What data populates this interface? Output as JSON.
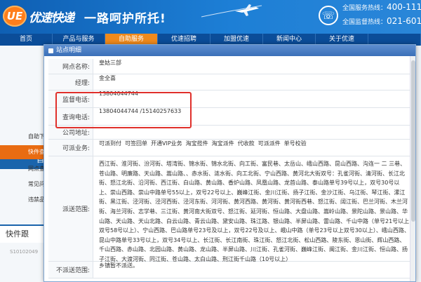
{
  "header": {
    "logo_mark": "UE",
    "logo_text": "优速快递",
    "slogan": "一路呵护所托!",
    "phone_icon": "phone-icon",
    "phone1_label": "全国服务热线：",
    "phone1": "400-111",
    "phone2_label": "全国监督热线：",
    "phone2": "021-601"
  },
  "nav": {
    "items": [
      {
        "label": "首页"
      },
      {
        "label": "产品与服务"
      },
      {
        "label": "自助服务"
      },
      {
        "label": "优速招聘"
      },
      {
        "label": "加盟优速"
      },
      {
        "label": "新闻中心"
      },
      {
        "label": "关于优速"
      },
      {
        "label": ""
      }
    ],
    "active_color": "#f08a1c"
  },
  "background_sidebar": {
    "items": [
      {
        "label": "自助下"
      },
      {
        "label": "快件查"
      },
      {
        "label": "网点查"
      },
      {
        "label": "常见问"
      },
      {
        "label": "违禁品"
      }
    ],
    "head": "自",
    "track_title": "快件跟",
    "track_number": "S10102049"
  },
  "dialog": {
    "title": "站点明细",
    "rows": {
      "name_label": "网点名称:",
      "name_value": "皇姑三部",
      "manager_label": "经理:",
      "manager_value": "金全喜",
      "supervise_label": "监督电话:",
      "supervise_value": "13804044744",
      "query_label": "查询电话:",
      "query_value": "13804044744 /15140257633",
      "address_label": "公司地址:",
      "address_value": "",
      "services_label": "可派业务:",
      "services": [
        "可派到付",
        "可签回单",
        "开通VIP业务",
        "淘宝揽件",
        "淘宝派件",
        "代收款",
        "可派派件",
        "单号校验"
      ],
      "area_label": "派送范围:",
      "area_value": "西江街、淮河街、汾河街、塔湾街、锦水街、锦水北街、向工街、富民巷、太岳山、峨山西路、昆山西路、沟连一 二 三巷、苍山路、明廉路、天山路、嵩山路、、赤水街、涟水街、向工北街、宁山西路、黄河北大街双号：孔雀河街、清河街、长江北街、怒江北街、沿河街、西江街、白山路、黄山路、香炉山路、凤凰山路、龙首山路、泰山路单号39号以上，双号30号以上、崇山西路、崇山中路单号55以上，双号22号以上、巍峰江街、金川江街、扬子江街、金沙江街、乌江街、琴江街、漯江街、黑江街、泾河街、泾河西街、泾河东街、河河街、黄河西路、黄河街、黄河街西巷、怒江街、阔江街、巴兰河街、木兰河街、海兰河街、志学巷、三江街、黄河南大街双号、怒江街、延河街、恒山路、大盘山路、嵩岭山路、景陀山路、景山路、华山路、天山路、天山北路、白云山路、青云山路、黛安山路、珠江路、银山路、半屏山路、雷山路、千山中路（单号21号以上 双号58号以上）、宁山西路、巴山路单号23号及以上，双号22号及以上、峨山中路（单号23号以上双号30以上）、峨山西路、昆山中路单号33号以上，双号34号以上、长江街、长江南街、珠江街、怒江北街、松山西路、陵东街、恩山街、辉山西路、千山西路、赤山路、北园山路、黄山路、龙山路、半屏山路、川江街、孔雀河街、巍峰江街、闽江街、金川江街、恒山路、扬子江街、大渡河街、同江街、苍山路、太白山路、刑江街千山路（10号以上）",
      "no_area_label": "不派送范围:",
      "no_area_value": "乡镇暂不派送。"
    }
  },
  "highlight_color": "#e0302b"
}
